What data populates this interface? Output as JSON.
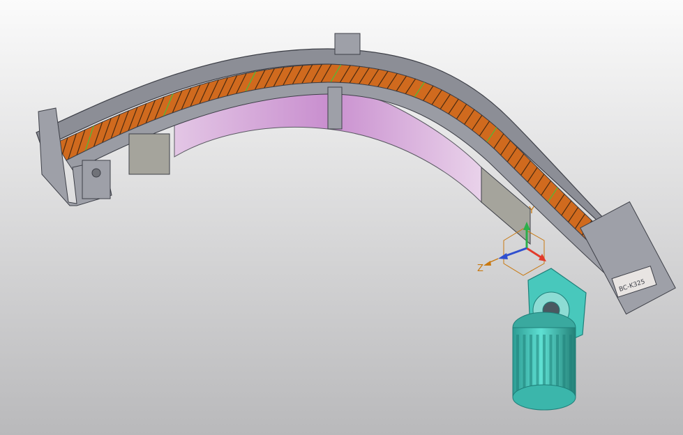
{
  "viewport": {
    "background_top": "#fbfbfb",
    "background_bottom": "#b9b9bb"
  },
  "model": {
    "frame_color": "#8c8e96",
    "frame_dark": "#3d3f47",
    "chain_color": "#d06a1e",
    "chain_highlight": "#4cbc3a",
    "guard_color": "#d5a6d8",
    "plate_color": "#a5a49c",
    "motor_color": "#48c8bc",
    "motor_dark": "#1f7f79",
    "chain_label": "BC-K325"
  },
  "triad": {
    "z_label": "Z",
    "y_label": "Y",
    "x_color": "#e23a2a",
    "y_color": "#2bb04a",
    "z_color": "#2f4fcf",
    "label_color": "#c87810"
  }
}
